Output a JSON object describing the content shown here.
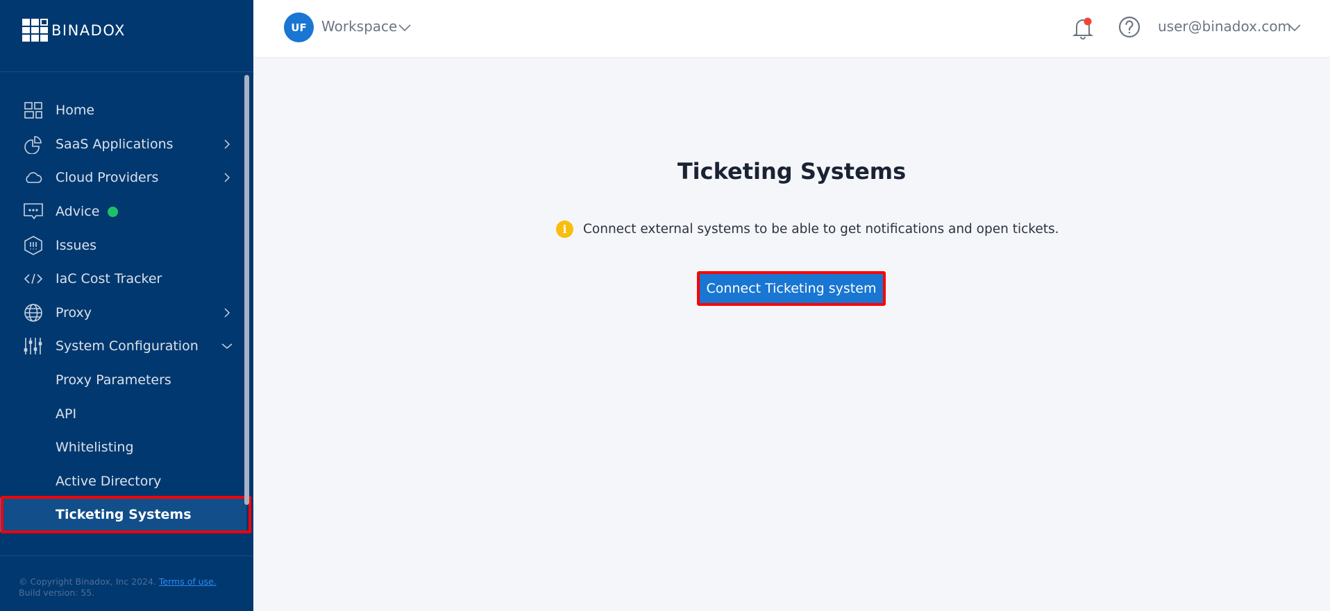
{
  "brand": {
    "name": "BINADOX"
  },
  "sidebar": {
    "items": [
      {
        "label": "Home",
        "icon": "home-grid-icon",
        "has_chevron": false
      },
      {
        "label": "SaaS Applications",
        "icon": "pie-chart-icon",
        "has_chevron": true
      },
      {
        "label": "Cloud Providers",
        "icon": "cloud-icon",
        "has_chevron": true
      },
      {
        "label": "Advice",
        "icon": "chat-bubble-icon",
        "has_chevron": false,
        "status_dot": "#1fbf6a"
      },
      {
        "label": "Issues",
        "icon": "hexagon-alert-icon",
        "has_chevron": false
      },
      {
        "label": "IaC Cost Tracker",
        "icon": "code-icon",
        "has_chevron": false
      },
      {
        "label": "Proxy",
        "icon": "globe-icon",
        "has_chevron": true
      },
      {
        "label": "System Configuration",
        "icon": "sliders-icon",
        "expanded": true
      }
    ],
    "sub_items": [
      {
        "label": "Proxy Parameters"
      },
      {
        "label": "API"
      },
      {
        "label": "Whitelisting"
      },
      {
        "label": "Active Directory"
      },
      {
        "label": "Ticketing Systems",
        "active": true
      }
    ],
    "footer": {
      "copyright": "© Copyright Binadox, Inc 2024.",
      "terms_link": "Terms of use.",
      "build": "Build version: 55."
    }
  },
  "header": {
    "workspace": {
      "initials": "UF",
      "name": "Workspace"
    },
    "notifications": {
      "has_unread": true
    },
    "user_email": "user@binadox.com"
  },
  "main": {
    "title": "Ticketing Systems",
    "info_text": "Connect external systems to be able to get notifications and open tickets.",
    "connect_button": "Connect Ticketing system"
  },
  "colors": {
    "sidebar_bg": "#01386f",
    "active_item_bg": "#124e8a",
    "primary": "#1976d2",
    "info_icon": "#f9bd0b",
    "advice_dot": "#1fbf6a",
    "notification_dot": "#f44336",
    "highlight_outline": "#ff0000"
  }
}
